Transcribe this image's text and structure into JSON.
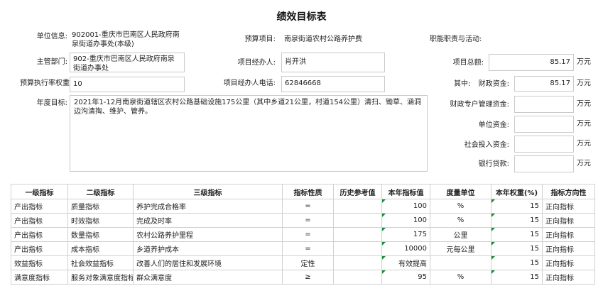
{
  "page": {
    "title": "绩效目标表"
  },
  "form": {
    "unit_info_label": "单位信息:",
    "unit_info_value": "902001-重庆市巴南区人民政府南泉街道办事处(本级)",
    "supervisor_label": "主管部门:",
    "supervisor_value": "902-重庆市巴南区人民政府南泉街道办事处",
    "budget_exec_rate_label": "预算执行率权重",
    "budget_exec_rate_value": "10",
    "annual_goal_label": "年度目标:",
    "annual_goal_value": "2021年1-12月南泉街道辖区农村公路基础设施175公里（其中乡道21公里，村道154公里）清扫、锄草、涵洞边沟清掏、维护、管养。",
    "budget_project_label": "预算项目:",
    "budget_project_value": "南泉街道农村公路养护费",
    "project_manager_label": "项目经办人:",
    "project_manager_value": "肖开洪",
    "manager_phone_label": "项目经办人电话:",
    "manager_phone_value": "62846668",
    "duty_label": "职能职责与活动:",
    "project_total_label": "项目总额:",
    "project_total_value": "85.17",
    "of_which_label": "其中:",
    "fiscal_funds_label": "财政资金:",
    "fiscal_funds_value": "85.17",
    "fiscal_special_label": "财政专户管理资金:",
    "fiscal_special_value": "",
    "unit_funds_label": "单位资金:",
    "unit_funds_value": "",
    "social_invest_label": "社会投入资金:",
    "social_invest_value": "",
    "bank_loan_label": "银行贷款:",
    "bank_loan_value": "",
    "unit_wan": "万元"
  },
  "table": {
    "headers": [
      "一级指标",
      "二级指标",
      "三级指标",
      "指标性质",
      "历史参考值",
      "本年指标值",
      "度量单位",
      "本年权重(%)",
      "指标方向性"
    ],
    "rows": [
      [
        "产出指标",
        "质量指标",
        "养护完成合格率",
        "=",
        "",
        "100",
        "%",
        "15",
        "正向指标"
      ],
      [
        "产出指标",
        "时效指标",
        "完成及时率",
        "=",
        "",
        "100",
        "%",
        "15",
        "正向指标"
      ],
      [
        "产出指标",
        "数量指标",
        "农村公路养护里程",
        "=",
        "",
        "175",
        "公里",
        "15",
        "正向指标"
      ],
      [
        "产出指标",
        "成本指标",
        "乡道养护成本",
        "=",
        "",
        "10000",
        "元每公里",
        "15",
        "正向指标"
      ],
      [
        "效益指标",
        "社会效益指标",
        "改善人们的居住和发展环境",
        "定性",
        "",
        "有效提高",
        "",
        "15",
        "正向指标"
      ],
      [
        "满意度指标",
        "服务对象满意度指标",
        "群众满意度",
        "≥",
        "",
        "95",
        "%",
        "15",
        "正向指标"
      ]
    ]
  }
}
